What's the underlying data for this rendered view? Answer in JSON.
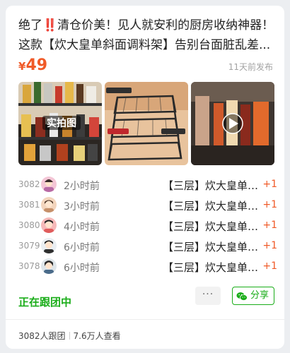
{
  "post": {
    "title": "绝了‼️清仓价美！见人就安利的厨房收纳神器！这款【炊大皇单斜面调料架】告别台面脏乱差...",
    "price_symbol": "¥",
    "price": "49",
    "posted": "11天前发布",
    "images": [
      {
        "icon": "spice-bottles-photo",
        "overlay_text": "实拍图"
      },
      {
        "icon": "metal-spice-rack-photo"
      },
      {
        "icon": "video-play-thumbnail"
      }
    ]
  },
  "orders": [
    {
      "num": "3082",
      "time": "2小时前",
      "item": "【三层】炊大皇单斜面调料架",
      "plus": "+1"
    },
    {
      "num": "3081",
      "time": "3小时前",
      "item": "【三层】炊大皇单斜面调料架",
      "plus": "+1"
    },
    {
      "num": "3080",
      "time": "4小时前",
      "item": "【三层】炊大皇单斜面调料架",
      "plus": "+1"
    },
    {
      "num": "3079",
      "time": "6小时前",
      "item": "【三层】炊大皇单斜面调料架",
      "plus": "+1"
    },
    {
      "num": "3078",
      "time": "6小时前",
      "item": "【三层】炊大皇单斜面调料架",
      "plus": "+1"
    }
  ],
  "footer": {
    "following": "正在跟团中",
    "more_label": "···",
    "share_label": "分享",
    "participants": "3082人跟团",
    "views": "7.6万人查看"
  },
  "colors": {
    "accent": "#f05a28",
    "green": "#1aad19"
  }
}
